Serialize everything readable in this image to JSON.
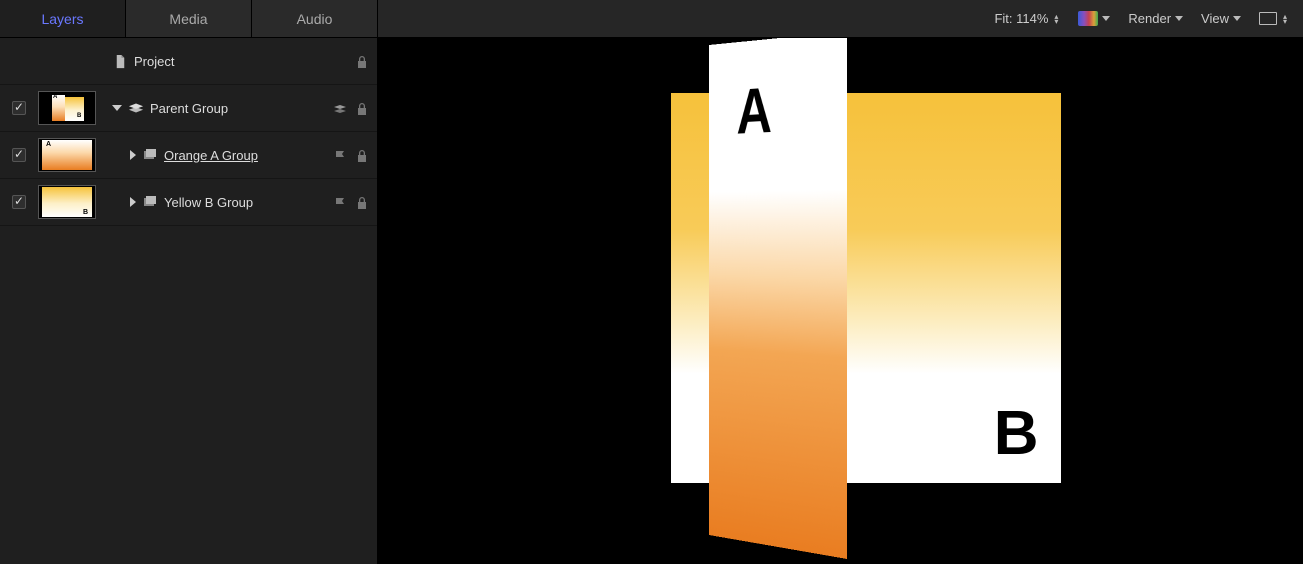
{
  "tabs": {
    "layers": "Layers",
    "media": "Media",
    "audio": "Audio"
  },
  "layers": {
    "project": {
      "name": "Project"
    },
    "parent": {
      "name": "Parent Group"
    },
    "orange": {
      "name": "Orange A Group"
    },
    "yellow": {
      "name": "Yellow B Group"
    }
  },
  "toolbar": {
    "fit_label": "Fit: 114%",
    "render_label": "Render",
    "view_label": "View"
  },
  "canvas": {
    "letter_a": "A",
    "letter_b": "B"
  }
}
